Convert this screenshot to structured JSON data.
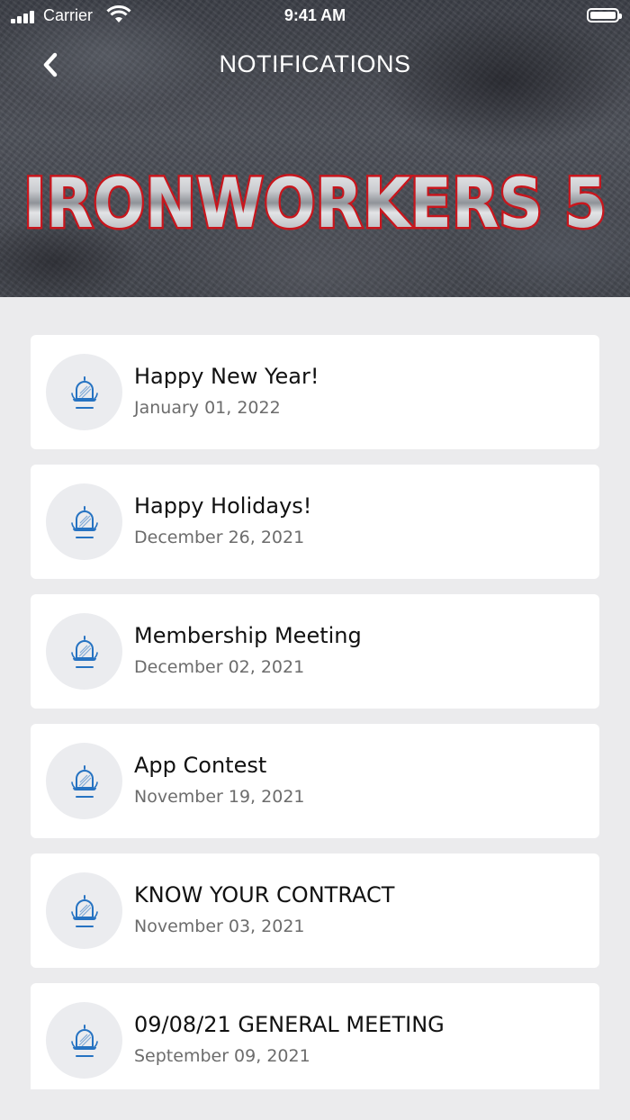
{
  "status_bar": {
    "carrier": "Carrier",
    "time": "9:41 AM"
  },
  "nav": {
    "back_icon": "chevron-left-icon",
    "title": "NOTIFICATIONS"
  },
  "banner": {
    "logo_text": "IRONWORKERS 5",
    "accent_color": "#c8161d"
  },
  "notifications": [
    {
      "title": "Happy New Year!",
      "date": "January 01, 2022",
      "icon": "bell-icon"
    },
    {
      "title": "Happy Holidays!",
      "date": "December 26, 2021",
      "icon": "bell-icon"
    },
    {
      "title": "Membership Meeting",
      "date": "December 02, 2021",
      "icon": "bell-icon"
    },
    {
      "title": "App Contest",
      "date": "November 19, 2021",
      "icon": "bell-icon"
    },
    {
      "title": "KNOW YOUR CONTRACT",
      "date": "November 03, 2021",
      "icon": "bell-icon"
    },
    {
      "title": "09/08/21 GENERAL MEETING",
      "date": "September 09, 2021",
      "icon": "bell-icon"
    }
  ]
}
